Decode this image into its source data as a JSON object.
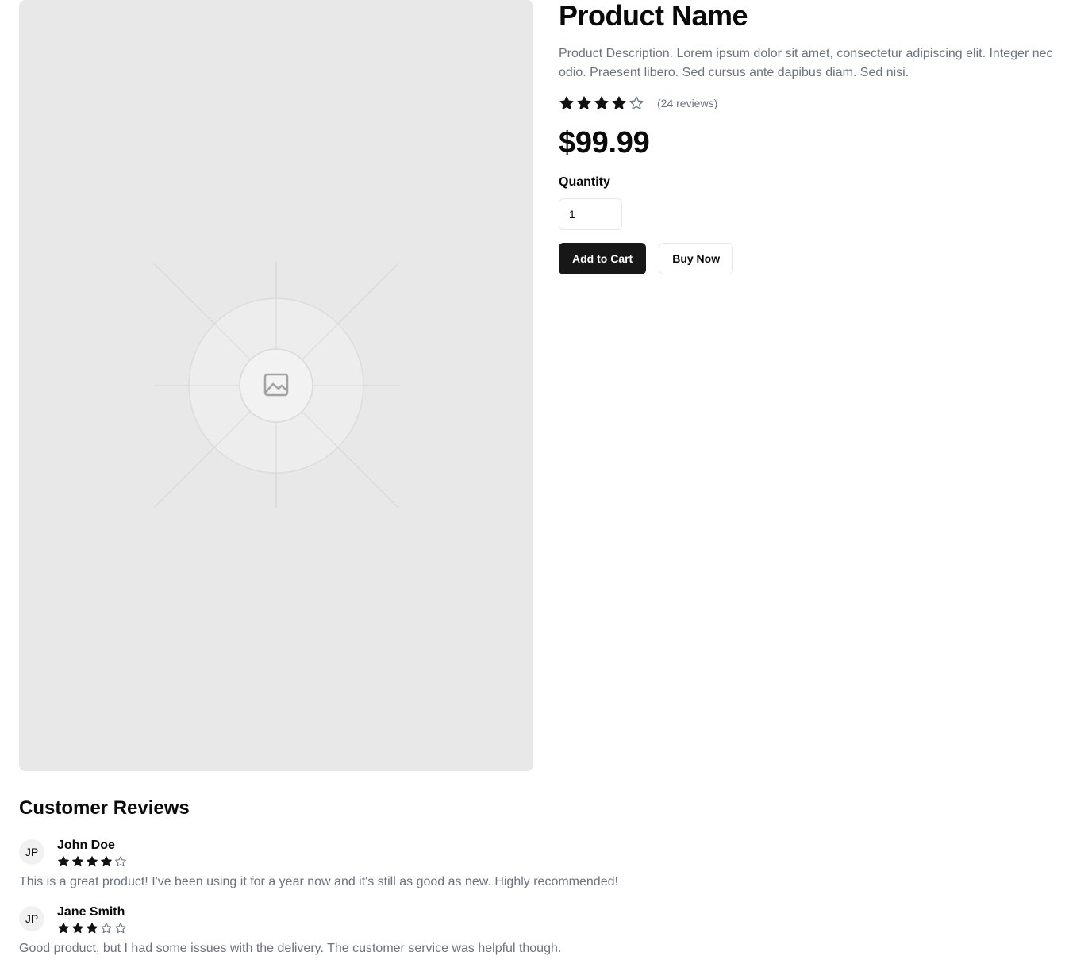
{
  "product": {
    "name": "Product Name",
    "description": "Product Description. Lorem ipsum dolor sit amet, consectetur adipiscing elit. Integer nec odio. Praesent libero. Sed cursus ante dapibus diam. Sed nisi.",
    "rating": 4,
    "max_rating": 5,
    "review_count_text": "(24 reviews)",
    "price": "$99.99",
    "image_icon": "image-placeholder-icon"
  },
  "quantity": {
    "label": "Quantity",
    "value": "1"
  },
  "actions": {
    "add_to_cart": "Add to Cart",
    "buy_now": "Buy Now"
  },
  "reviews": {
    "title": "Customer Reviews",
    "items": [
      {
        "initials": "JP",
        "name": "John Doe",
        "rating": 4,
        "text": "This is a great product! I've been using it for a year now and it's still as good as new. Highly recommended!"
      },
      {
        "initials": "JP",
        "name": "Jane Smith",
        "rating": 3,
        "text": "Good product, but I had some issues with the delivery. The customer service was helpful though."
      }
    ]
  },
  "colors": {
    "primary": "#171717",
    "muted_text": "#6b7280",
    "star_fill": "#111111",
    "image_bg": "#e8e8e8"
  }
}
